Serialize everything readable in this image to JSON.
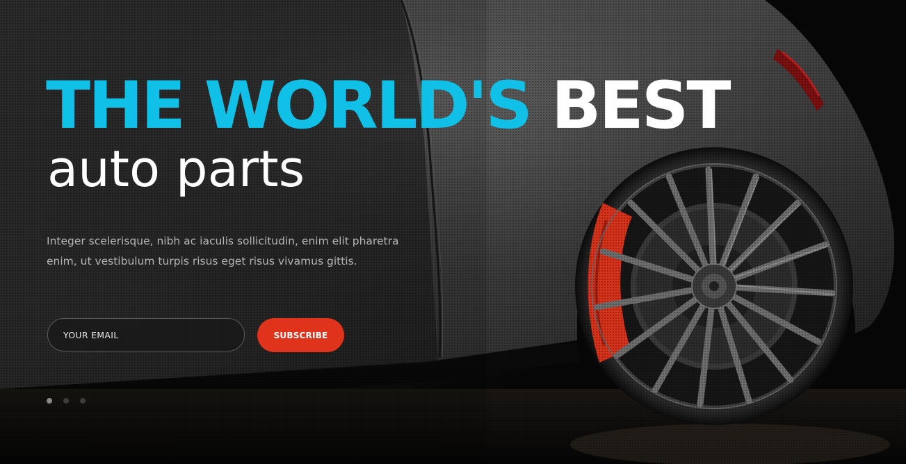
{
  "hero": {
    "headline_accent": "THE WORLD'S",
    "headline_strong": "BEST",
    "subheadline": "auto parts",
    "description": "Integer scelerisque, nibh ac iaculis sollicitudin, enim elit pharetra enim, ut vestibulum turpis risus eget risus vivamus gittis."
  },
  "subscribe": {
    "email_placeholder": "YOUR EMAIL",
    "email_value": "",
    "button_label": "SUBSCRIBE"
  },
  "slider": {
    "slide_count": 3,
    "active_index": 0
  },
  "colors": {
    "accent": "#10c0e6",
    "button": "#e0331b",
    "headline_strong": "#ffffff",
    "description": "#b4b4b4",
    "background": "#0a0a0a"
  },
  "icons": {
    "background_image": "sports-car-wheel-photo"
  }
}
